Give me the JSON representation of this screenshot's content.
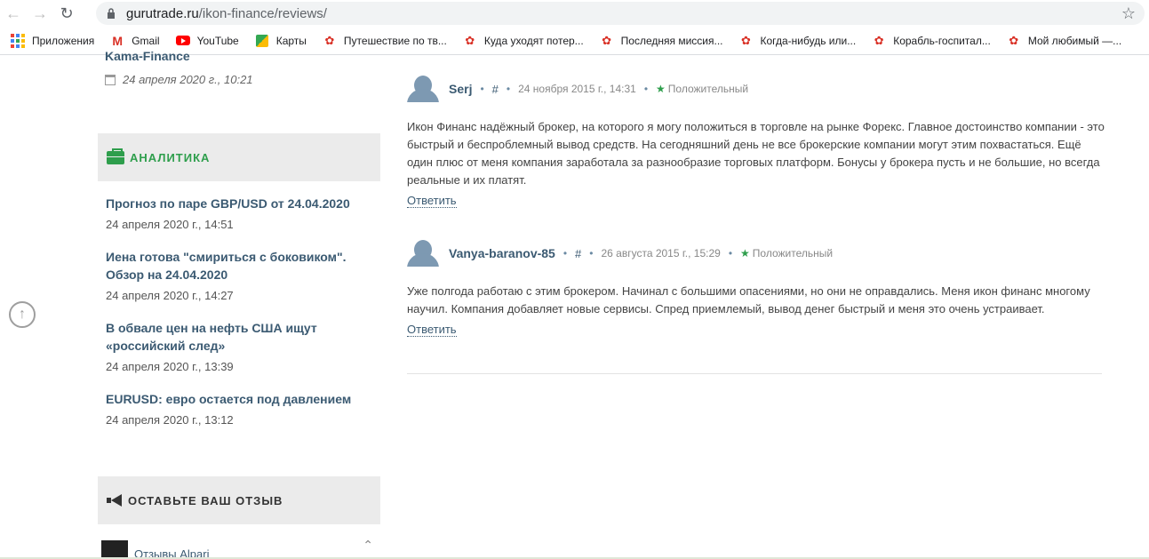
{
  "browser": {
    "url_host": "gurutrade.ru",
    "url_path": "/ikon-finance/reviews/",
    "bookmarks": [
      {
        "label": "Приложения",
        "icon": "apps-icon"
      },
      {
        "label": "Gmail",
        "icon": "gmail-icon"
      },
      {
        "label": "YouTube",
        "icon": "youtube-icon"
      },
      {
        "label": "Карты",
        "icon": "maps-icon"
      },
      {
        "label": "Путешествие по тв...",
        "icon": "favicon-icon"
      },
      {
        "label": "Куда уходят потер...",
        "icon": "favicon-icon"
      },
      {
        "label": "Последняя миссия...",
        "icon": "favicon-icon"
      },
      {
        "label": "Когда-нибудь или...",
        "icon": "favicon-icon"
      },
      {
        "label": "Корабль-госпитал...",
        "icon": "favicon-icon"
      },
      {
        "label": "Мой любимый —...",
        "icon": "favicon-icon"
      }
    ]
  },
  "sidebar": {
    "prev_item": {
      "title": "Kama-Finance",
      "date": "24 апреля 2020 г., 10:21"
    },
    "analytics_title": "АНАЛИТИКА",
    "news": [
      {
        "title": "Прогноз по паре GBP/USD от 24.04.2020",
        "date": "24 апреля 2020 г., 14:51"
      },
      {
        "title": "Иена готова \"смириться с боковиком\". Обзор на 24.04.2020",
        "date": "24 апреля 2020 г., 14:27"
      },
      {
        "title": "В обвале цен на нефть США ищут «российский след»",
        "date": "24 апреля 2020 г., 13:39"
      },
      {
        "title": "EURUSD: евро остается под давлением",
        "date": "24 апреля 2020 г., 13:12"
      }
    ],
    "review_widget_title": "ОСТАВЬТЕ ВАШ ОТЗЫВ",
    "list_item": "Отзывы Alpari"
  },
  "reviews": [
    {
      "author": "Serj",
      "hash": "#",
      "date": "24 ноября 2015 г., 14:31",
      "rating": "Положительный",
      "text": "Икон Финанс надёжный брокер, на которого я могу положиться в торговле на рынке Форекс. Главное достоинство компании - это быстрый и беспроблемный вывод средств. На сегодняшний день не все брокерские компании могут этим похвастаться. Ещё один плюс от меня компания заработала за разнообразие торговых платформ. Бонусы у брокера пусть и не большие, но всегда реальные и их платят.",
      "reply": "Ответить"
    },
    {
      "author": "Vanya-baranov-85",
      "hash": "#",
      "date": "26 августа 2015 г., 15:29",
      "rating": "Положительный",
      "text": "Уже полгода работаю с этим брокером. Начинал с большими опасениями, но они не оправдались. Меня икон финанс многому научил. Компания добавляет новые сервисы. Спред приемлемый, вывод денег быстрый и меня это очень устраивает.",
      "reply": "Ответить"
    }
  ]
}
